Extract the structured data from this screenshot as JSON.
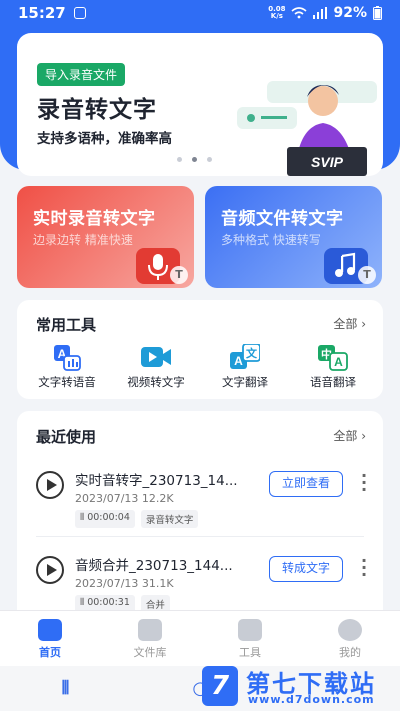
{
  "status_bar": {
    "time": "15:27",
    "net_speed_value": "0.08",
    "net_speed_unit": "K/s",
    "battery": "92%"
  },
  "banner": {
    "tag": "导入录音文件",
    "title": "录音转文字",
    "subtitle": "支持多语种，准确率高",
    "badge": "SVIP",
    "carousel_total": 3,
    "carousel_active": 2
  },
  "features": [
    {
      "title": "实时录音转文字",
      "subtitle": "边录边转 精准快速",
      "icon": "mic-icon",
      "color": "#f05046"
    },
    {
      "title": "音频文件转文字",
      "subtitle": "多种格式 快速转写",
      "icon": "music-file-icon",
      "color": "#3b6ff3"
    }
  ],
  "tools": {
    "title": "常用工具",
    "more": "全部",
    "items": [
      {
        "label": "文字转语音",
        "icon": "text-to-speech-icon"
      },
      {
        "label": "视频转文字",
        "icon": "video-icon"
      },
      {
        "label": "文字翻译",
        "icon": "translate-icon"
      },
      {
        "label": "语音翻译",
        "icon": "voice-translate-icon"
      }
    ]
  },
  "recent": {
    "title": "最近使用",
    "more": "全部",
    "items": [
      {
        "name": "实时音转字_230713_14...",
        "meta": "2023/07/13 12.2K",
        "duration": "00:00:04",
        "tag": "录音转文字",
        "action": "立即查看"
      },
      {
        "name": "音频合并_230713_144...",
        "meta": "2023/07/13 31.1K",
        "duration": "00:00:31",
        "tag": "合并",
        "action": "转成文字"
      }
    ]
  },
  "tabbar": {
    "items": [
      {
        "label": "首页",
        "icon": "home-icon",
        "active": true
      },
      {
        "label": "文件库",
        "icon": "file-library-icon",
        "active": false
      },
      {
        "label": "工具",
        "icon": "toolbox-icon",
        "active": false
      },
      {
        "label": "我的",
        "icon": "profile-icon",
        "active": false
      }
    ]
  },
  "watermark": {
    "title": "第七下载站",
    "url": "www.d7down.com",
    "logo": "7"
  },
  "colors": {
    "primary": "#2f6df5",
    "green_tag": "#1aa866",
    "red_card": "#f05046"
  }
}
